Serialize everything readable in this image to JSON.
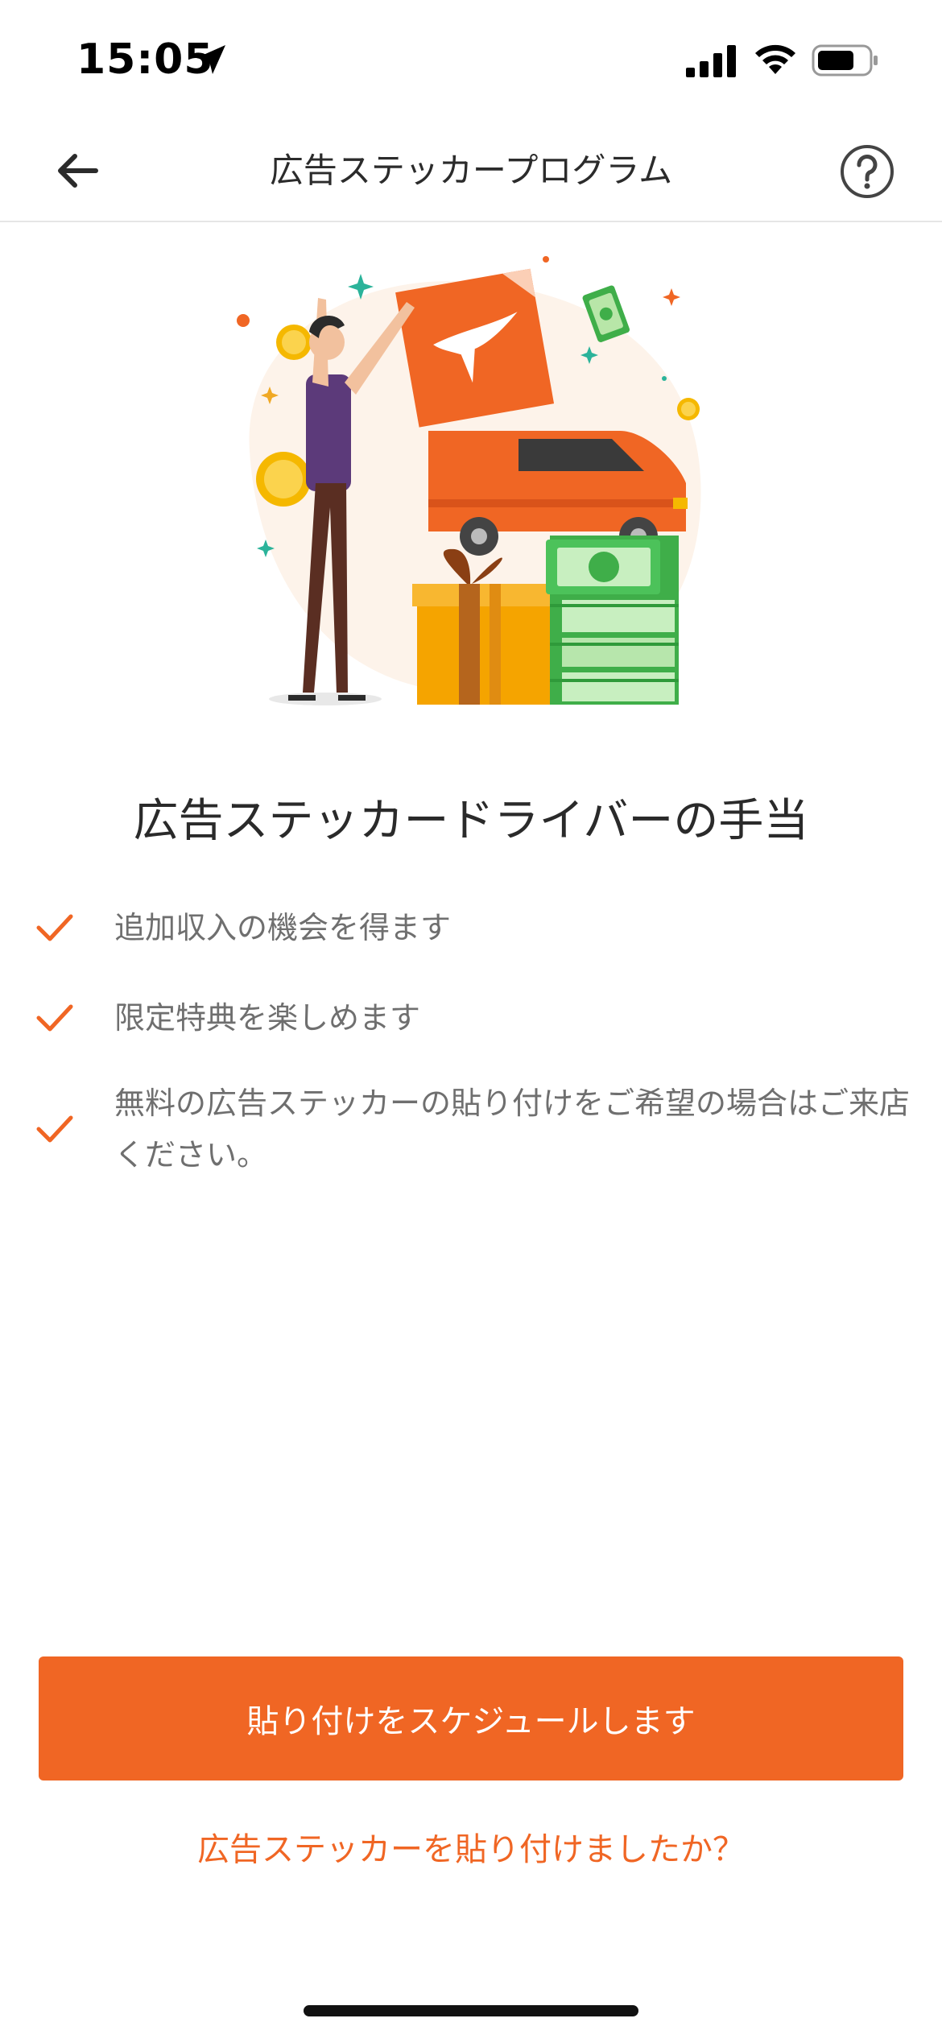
{
  "status_bar": {
    "time": "15:05"
  },
  "nav": {
    "title": "広告ステッカープログラム"
  },
  "main": {
    "heading": "広告ステッカードライバーの手当",
    "benefits": [
      {
        "text": "追加収入の機会を得ます"
      },
      {
        "text": "限定特典を楽しめます"
      },
      {
        "text": "無料の広告ステッカーの貼り付けをご希望の場合はご来店ください。"
      }
    ]
  },
  "actions": {
    "schedule_label": "貼り付けをスケジュールします",
    "applied_link": "広告ステッカーを貼り付けましたか？"
  },
  "colors": {
    "accent": "#f06624",
    "text_muted": "#6f6f6f",
    "money_green": "#3fae49"
  },
  "icons": [
    "location-arrow-icon",
    "signal-icon",
    "wifi-icon",
    "battery-icon",
    "back-arrow-icon",
    "help-icon",
    "check-icon"
  ]
}
